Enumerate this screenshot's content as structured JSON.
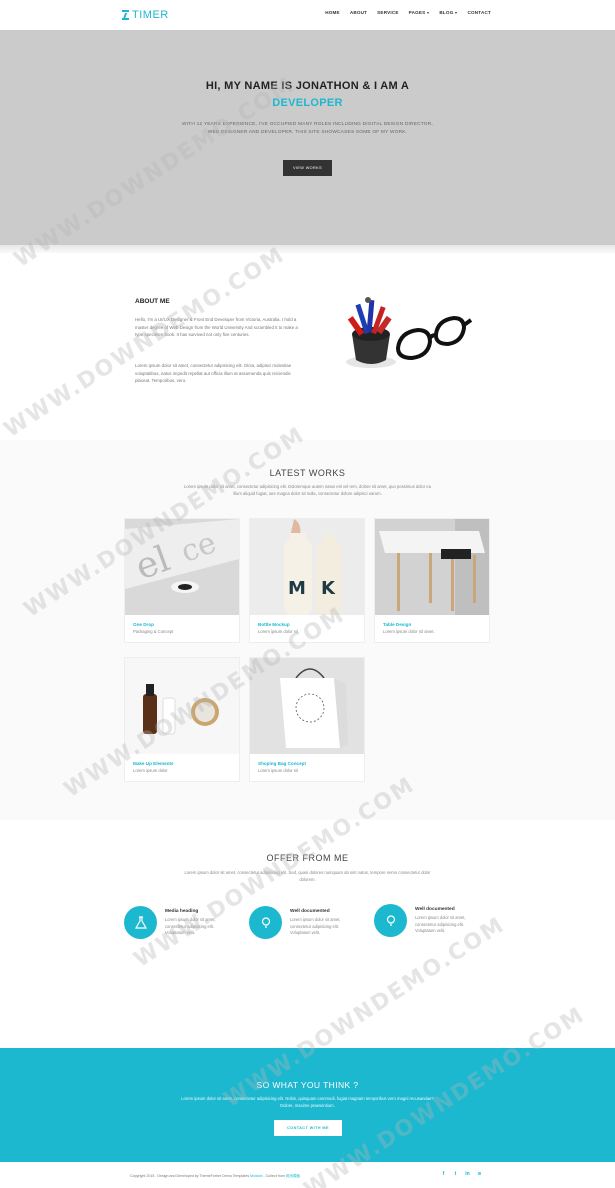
{
  "nav": {
    "logo": "TIMER",
    "items": [
      {
        "label": "HOME",
        "dropdown": false
      },
      {
        "label": "ABOUT",
        "dropdown": false
      },
      {
        "label": "SERVICE",
        "dropdown": false
      },
      {
        "label": "PAGES",
        "dropdown": true
      },
      {
        "label": "BLOG",
        "dropdown": true
      },
      {
        "label": "CONTACT",
        "dropdown": false
      }
    ]
  },
  "hero": {
    "title_line1": "HI, MY NAME IS JONATHON & I AM A",
    "title_line2": "DEVELOPER",
    "desc_line1": "WITH 12 YEARS EXPERIENCE, I'VE OCCUPIED MANY ROLES INCLUDING DIGITAL DESIGN DIRECTOR,",
    "desc_line2": "WEB DESIGNER AND DEVELOPER. THIS SITE SHOWCASES SOME OF MY WORK.",
    "button": "VIEW WORKS"
  },
  "about": {
    "title": "ABOUT ME",
    "p1": "Hello, I'm a UI/UX Designer & Front End Developer from Victoria, Australia. I hold a master degree of Web Design from the World University And scrambled it to make a type specimen book. It has survived not only five centuries.",
    "p2": "Lorem ipsum dolor sit amet, consectetur adipisicing elit. Dicta, adipisci molestiae voluptatibus, natus impedit repellat aut officia illum at assumenda quis reiciendis placeat. Temporibus, vero."
  },
  "works": {
    "title": "LATEST WORKS",
    "subtitle": "Lorem ipsum dolor sit amet, consectetur adipisicing elit. Doloremque autem natus est vel rem, dolore sit amet, quo possimus dolor ea illum aliquid fugiat, iure magna dolor sit nulla, consectetur dolore adipisci earum.",
    "items": [
      {
        "title": "One Drop",
        "subtitle": "Packaging & Concept"
      },
      {
        "title": "Bottle Mockup",
        "subtitle": "Lorem ipsum dolor sit"
      },
      {
        "title": "Table Design",
        "subtitle": "Lorem ipsum dolor sit amet."
      },
      {
        "title": "Make Up Elements",
        "subtitle": "Lorem ipsum dolor"
      },
      {
        "title": "Shoping Bag Concept",
        "subtitle": "Lorem ipsum dolor sit"
      }
    ]
  },
  "offer": {
    "title": "OFFER FROM ME",
    "subtitle": "Lorem ipsum dolor sit amet, consectetur adipisicing elit. Sed, quasi dolores numquam ab sint natus, tempore nemo consectetur dolor dolorem.",
    "items": [
      {
        "title": "Media heading",
        "desc": "Lorem ipsum dolor sit amet, consectetur adipisicing elit. Voluptatum velit.",
        "icon": "flask-icon"
      },
      {
        "title": "Well documented",
        "desc": "Lorem ipsum dolor sit amet, consectetur adipisicing elit. Voluptatum velit.",
        "icon": "lightbulb-icon"
      },
      {
        "title": "Well documented",
        "desc": "Lorem ipsum dolor sit amet, consectetur adipisicing elit. Voluptatum velit.",
        "icon": "lightbulb-icon"
      }
    ]
  },
  "cta": {
    "title": "SO WHAT YOU THINK ?",
    "desc": "Lorem ipsum dolor sit amet, consectetur adipisicing elit. Nobis, quisquam commodi, fugiat magnam temporibus vero magni recusandae? Dolore, maxime praesentium.",
    "button": "CONTACT WITH ME"
  },
  "footer": {
    "copyright": "Copyright 2015 . Design and Developed by ThemeForher Demo Templates",
    "brand1": "Mxictob",
    "sep": " - Collect from ",
    "brand2": "网页模板"
  },
  "social": [
    "facebook-icon",
    "twitter-icon",
    "linkedin-icon",
    "rss-icon"
  ],
  "watermark": "WWW.DOWNDEMO.COM",
  "colors": {
    "accent": "#1cb8cf",
    "hero_bg": "#cbcbcb",
    "dark_button": "#333333"
  }
}
